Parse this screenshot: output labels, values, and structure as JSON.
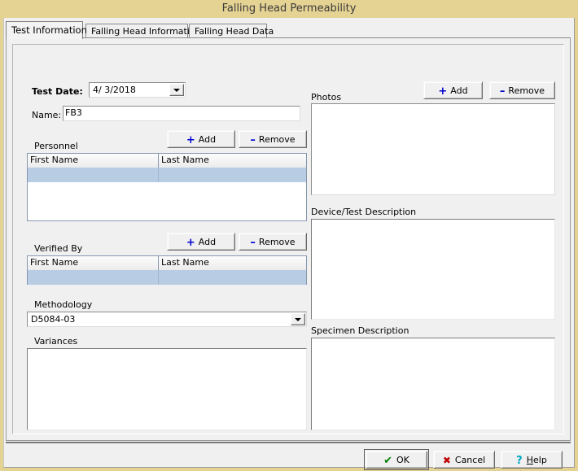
{
  "window": {
    "title": "Falling Head Permeability"
  },
  "tabs": [
    {
      "label": "Test Information",
      "active": true
    },
    {
      "label": "Falling Head Information",
      "active": false
    },
    {
      "label": "Falling Head Data",
      "active": false
    }
  ],
  "form": {
    "test_date": {
      "label": "Test Date:",
      "value": "4/  3/2018"
    },
    "name": {
      "label": "Name:",
      "value": "FB3"
    },
    "personnel": {
      "label": "Personnel",
      "add_label": "Add",
      "remove_label": "Remove",
      "add_symbol": "+",
      "remove_symbol": "–",
      "columns": [
        "First Name",
        "Last Name"
      ],
      "rows": [
        {
          "first_name": "",
          "last_name": "",
          "selected": true
        }
      ]
    },
    "verified_by": {
      "label": "Verified By",
      "add_label": "Add",
      "remove_label": "Remove",
      "add_symbol": "+",
      "remove_symbol": "–",
      "columns": [
        "First Name",
        "Last Name"
      ],
      "rows": [
        {
          "first_name": "",
          "last_name": "",
          "selected": true
        }
      ]
    },
    "methodology": {
      "label": "Methodology",
      "value": "D5084-03"
    },
    "variances": {
      "label": "Variances",
      "value": ""
    },
    "photos": {
      "label": "Photos",
      "add_label": "Add",
      "remove_label": "Remove",
      "add_symbol": "+",
      "remove_symbol": "–",
      "items": []
    },
    "device_test_description": {
      "label": "Device/Test Description",
      "value": ""
    },
    "specimen_description": {
      "label": "Specimen Description",
      "value": ""
    }
  },
  "footer": {
    "ok": {
      "label": "OK",
      "icon": "check-icon",
      "glyph": "✔"
    },
    "cancel": {
      "label": "Cancel",
      "icon": "cross-icon",
      "glyph": "✖"
    },
    "help": {
      "label": "Help",
      "icon": "question-icon",
      "glyph": "?",
      "accel": "H",
      "rest": "elp"
    }
  },
  "colors": {
    "titlebar": "#e5d394",
    "face": "#f0f0f0",
    "selection": "#b8cce4",
    "accent_blue": "#0000d0"
  }
}
